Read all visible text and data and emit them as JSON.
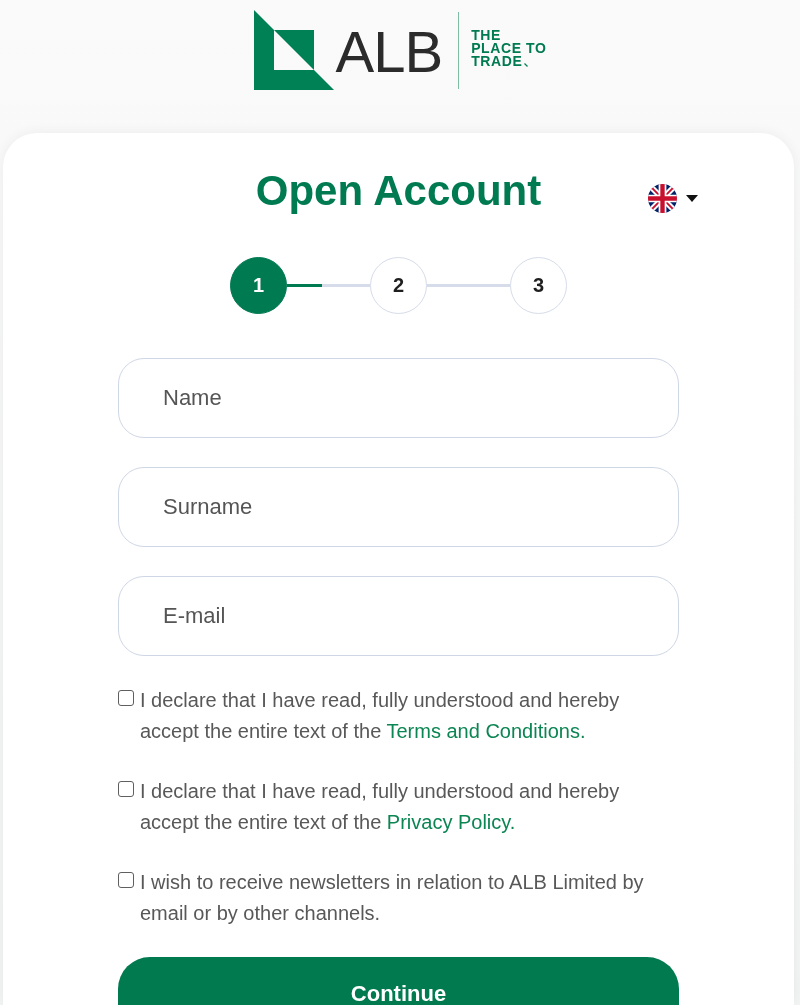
{
  "logo": {
    "wordmark": "ALB",
    "tagline": [
      "THE",
      "PLACE TO",
      "TRADE"
    ]
  },
  "title": "Open Account",
  "stepper": {
    "steps": [
      {
        "label": "1",
        "selected": true
      },
      {
        "label": "2",
        "selected": false
      },
      {
        "label": "3",
        "selected": false
      }
    ],
    "connectors": [
      {
        "level": 0.42
      }
    ]
  },
  "fields": [
    {
      "placeholder": "Name"
    },
    {
      "placeholder": "Surname"
    },
    {
      "placeholder": "E-mail"
    }
  ],
  "consents": [
    {
      "text": "I declare that I have read, fully understood and hereby accept the entire text of the",
      "link": "Terms and Conditions.",
      "checked": false
    },
    {
      "text": "I declare that I have read, fully understood and hereby accept the entire text of the",
      "link": "Privacy Policy.",
      "checked": false
    },
    {
      "text": "I wish to receive newsletters in relation to ALB Limited by email or by other channels.",
      "checked": false
    }
  ],
  "submit": {
    "label": "Continue"
  }
}
